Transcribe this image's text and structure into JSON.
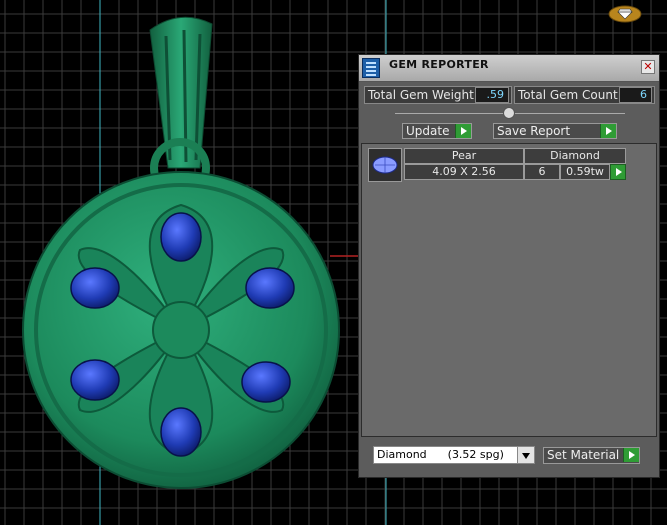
{
  "panel": {
    "title": "GEM REPORTER",
    "close_glyph": "✕",
    "total_weight_label": "Total Gem Weight",
    "total_weight_value": ".59",
    "total_count_label": "Total Gem Count",
    "total_count_value": "6",
    "update_label": "Update",
    "save_report_label": "Save Report",
    "gem_list": [
      {
        "shape": "Pear",
        "size": "4.09 X 2.56",
        "material": "Diamond",
        "count": "6",
        "weight": "0.59tw"
      }
    ],
    "material_select": {
      "value": "Diamond      (3.52 spg)"
    },
    "set_material_label": "Set Material"
  },
  "icons": {
    "title": "gem-reporter-app-icon",
    "logo": "diamond-logo-icon",
    "thumb": "pear-gem-thumbnail-icon",
    "close": "close-icon",
    "arrow": "play-arrow-icon"
  },
  "colors": {
    "pendant_green": "#1e8f61",
    "gem_blue": "#1f3bb4",
    "grid": "#3a3a3a",
    "axis_cyan": "#3fb8c4",
    "axis_red": "#b22222",
    "accent_green": "#2f9c35"
  }
}
